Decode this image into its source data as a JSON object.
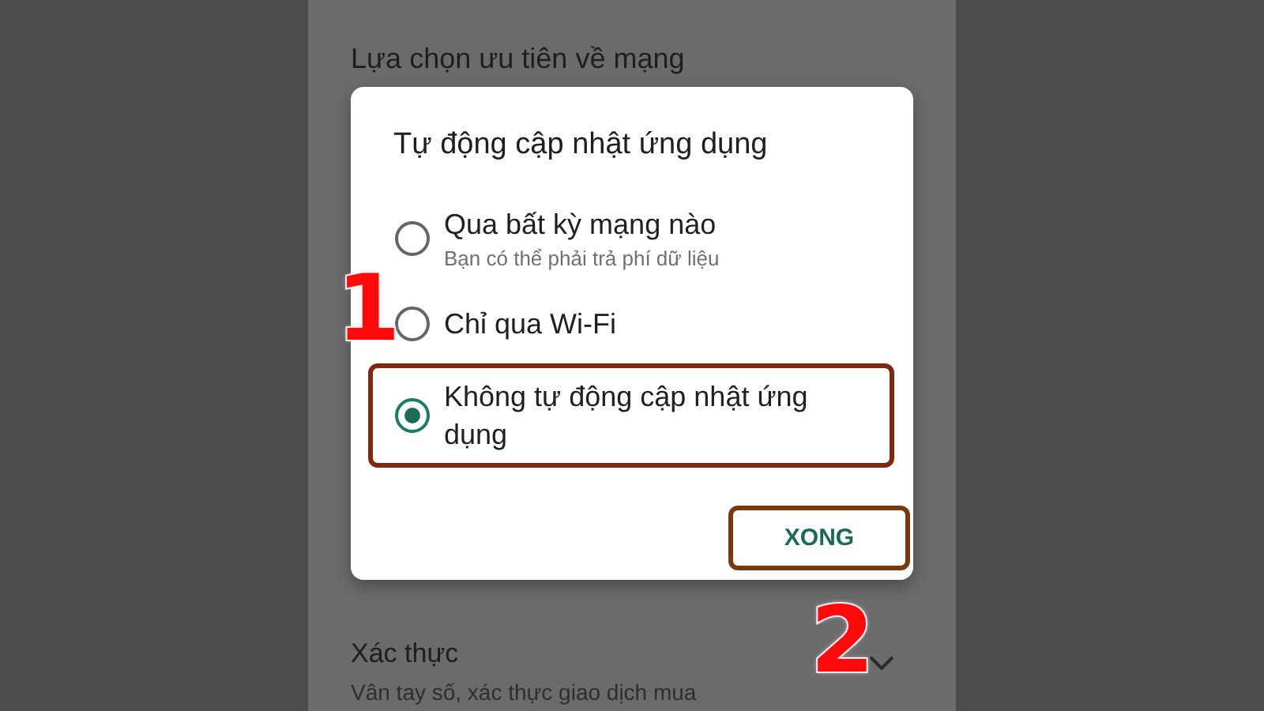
{
  "background": {
    "section_title": "Lựa chọn ưu tiên về mạng",
    "item_title": "Xác thực",
    "item_subtitle": "Vân tay số, xác thực giao dịch mua"
  },
  "dialog": {
    "title": "Tự động cập nhật ứng dụng",
    "options": [
      {
        "label": "Qua bất kỳ mạng nào",
        "sublabel": "Bạn có thể phải trả phí dữ liệu",
        "selected": false,
        "highlighted": false
      },
      {
        "label": "Chỉ qua Wi-Fi",
        "selected": false,
        "highlighted": false
      },
      {
        "label": "Không tự động cập nhật ứng dụng",
        "selected": true,
        "highlighted": true
      }
    ],
    "button": {
      "label": "XONG",
      "highlighted": true
    }
  },
  "annotations": [
    {
      "label": "1"
    },
    {
      "label": "2"
    }
  ]
}
